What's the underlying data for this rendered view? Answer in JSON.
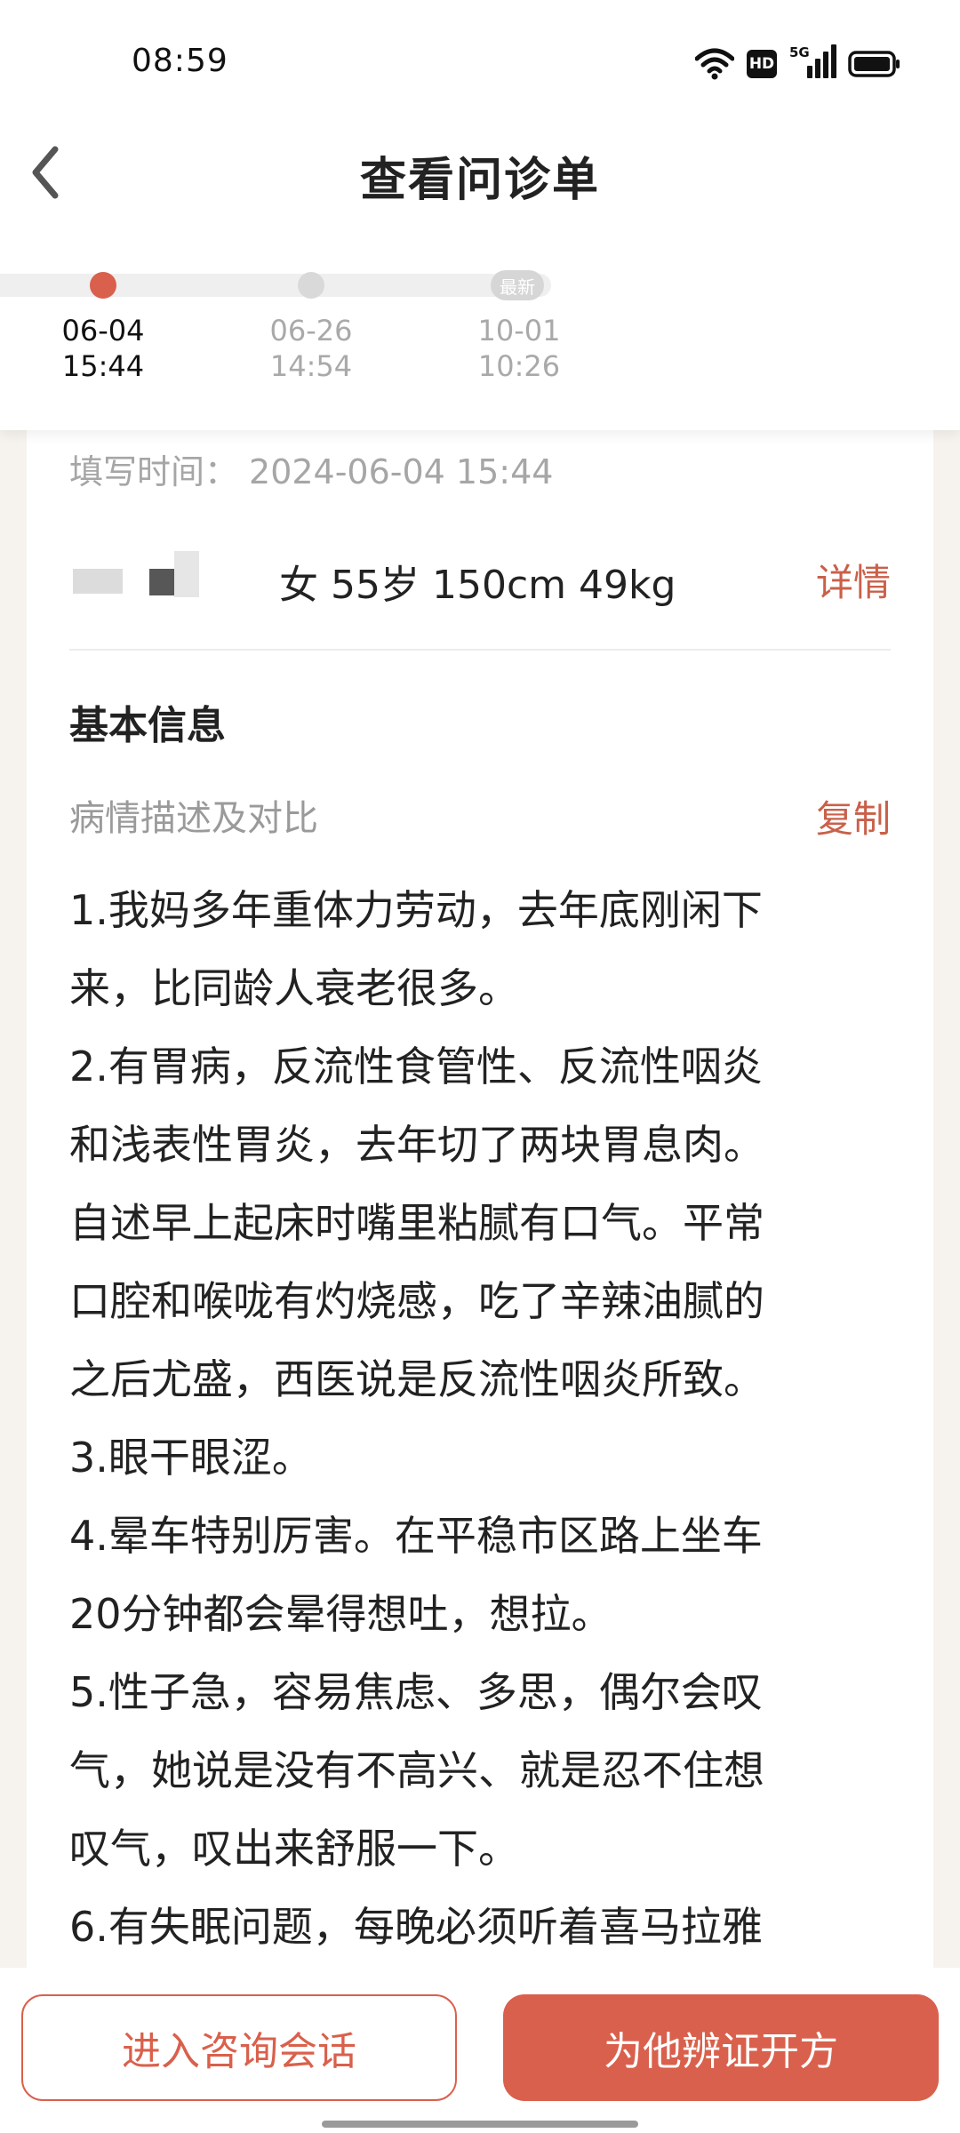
{
  "status_bar": {
    "time": "08:59",
    "hd_label": "HD",
    "network_label": "5G",
    "icons": [
      "wifi-icon",
      "hd-icon",
      "signal-5g-icon",
      "battery-icon"
    ]
  },
  "nav": {
    "title": "查看问诊单",
    "back_icon": "back-arrow-icon"
  },
  "timeline": {
    "latest_badge": "最新",
    "items": [
      {
        "date": "06-04",
        "time": "15:44",
        "active": true
      },
      {
        "date": "06-26",
        "time": "14:54",
        "active": false
      },
      {
        "date": "10-01",
        "time": "10:26",
        "active": false
      }
    ]
  },
  "form": {
    "fill_time_label": "填写时间：",
    "fill_time_value": "2024-06-04 15:44",
    "patient_info": "女 55岁 150cm 49kg",
    "detail_label": "详情",
    "section_title": "基本信息",
    "desc_label": "病情描述及对比",
    "copy_label": "复制",
    "description": "1.我妈多年重体力劳动，去年底刚闲下\n来，比同龄人衰老很多。\n2.有胃病，反流性食管性、反流性咽炎\n和浅表性胃炎，去年切了两块胃息肉。\n自述早上起床时嘴里粘腻有口气。平常\n口腔和喉咙有灼烧感，吃了辛辣油腻的\n之后尤盛，西医说是反流性咽炎所致。\n3.眼干眼涩。\n4.晕车特别厉害。在平稳市区路上坐车\n20分钟都会晕得想吐，想拉。\n5.性子急，容易焦虑、多思，偶尔会叹\n气，她说是没有不高兴、就是忍不住想\n叹气，叹出来舒服一下。\n6.有失眠问题，每晚必须听着喜马拉雅"
  },
  "actions": {
    "consult_label": "进入咨询会话",
    "prescribe_label": "为他辨证开方"
  },
  "colors": {
    "accent": "#d9604c",
    "link": "#c9604a",
    "muted": "#a6a6a6"
  }
}
